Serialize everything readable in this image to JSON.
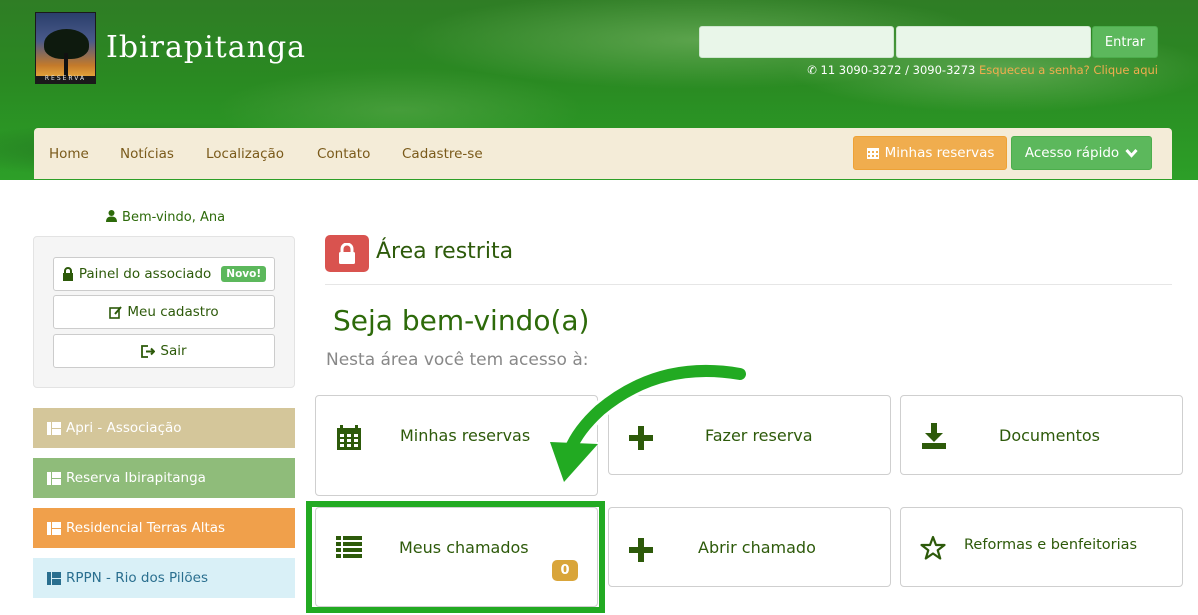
{
  "brand": {
    "name": "Ibirapitanga",
    "logo_text": "RESERVA"
  },
  "login": {
    "user_placeholder": "",
    "pass_placeholder": "",
    "submit_label": "Entrar",
    "phone": "11 3090-3272 / 3090-3273",
    "forgot": "Esqueceu a senha? Clique aqui"
  },
  "nav": {
    "items": [
      "Home",
      "Notícias",
      "Localização",
      "Contato",
      "Cadastre-se"
    ],
    "reservas_label": "Minhas reservas",
    "acesso_label": "Acesso rápido"
  },
  "sidebar": {
    "welcome": "Bem-vindo, Ana",
    "painel_label": "Painel do associado",
    "novo_badge": "Novo!",
    "cadastro_label": "Meu cadastro",
    "sair_label": "Sair",
    "links": [
      {
        "label": "Apri - Associação",
        "color": "#d4c69a"
      },
      {
        "label": "Reserva Ibirapitanga",
        "color": "#8fbc7a"
      },
      {
        "label": "Residencial Terras Altas",
        "color": "#f0a04b"
      },
      {
        "label": "RPPN - Rio dos Pilões",
        "color": "#d9f0f7"
      }
    ]
  },
  "main": {
    "area_title": "Área restrita",
    "welcome_title": "Seja bem-vindo(a)",
    "subtitle": "Nesta área você tem acesso à:",
    "tiles": [
      {
        "label": "Minhas reservas",
        "icon": "calendar-icon"
      },
      {
        "label": "Fazer reserva",
        "icon": "plus-icon"
      },
      {
        "label": "Documentos",
        "icon": "download-icon"
      },
      {
        "label": "Meus chamados",
        "icon": "list-icon",
        "badge": "0"
      },
      {
        "label": "Abrir chamado",
        "icon": "plus-icon"
      },
      {
        "label": "Reformas e benfeitorias",
        "icon": "star-icon"
      }
    ]
  },
  "colors": {
    "primary_green": "#5cb85c",
    "orange": "#f0ad4e",
    "danger": "#d9534f",
    "text_green": "#2d5a0a",
    "highlight": "#22aa22"
  }
}
